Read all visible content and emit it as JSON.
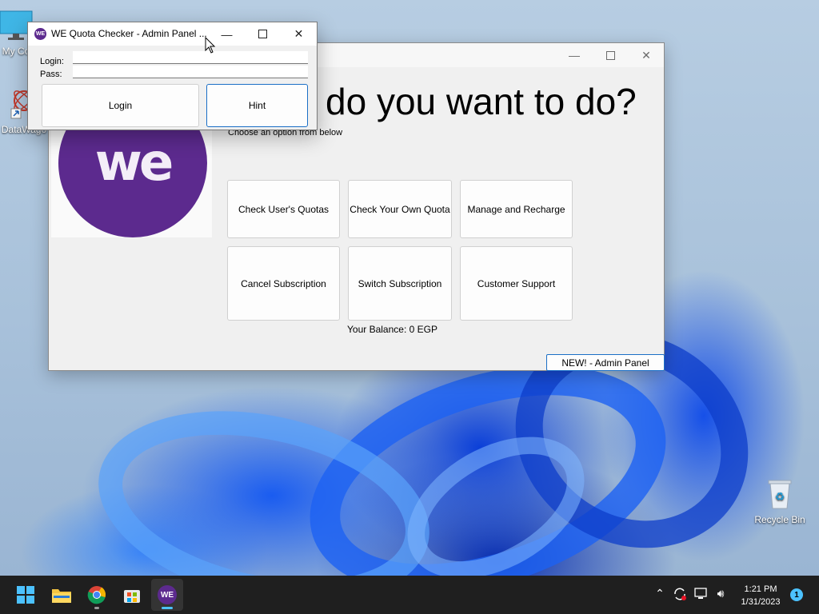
{
  "desktop": {
    "icons": [
      {
        "label": "My Co"
      },
      {
        "label": "DataWago"
      },
      {
        "label": "Recycle Bin"
      }
    ]
  },
  "main_window": {
    "heading": "do you want to do?",
    "subheading": "Choose an option from below",
    "logo_text": "we",
    "options": [
      {
        "label": "Check User's Quotas"
      },
      {
        "label": "Check Your Own Quota"
      },
      {
        "label": "Manage and Recharge"
      },
      {
        "label": "Cancel Subscription"
      },
      {
        "label": "Switch Subscription"
      },
      {
        "label": "Customer Support"
      }
    ],
    "balance": "Your Balance: 0 EGP",
    "admin_panel_label": "NEW! - Admin Panel"
  },
  "login_window": {
    "title": "WE Quota Checker - Admin Panel ...",
    "app_icon_text": "WE",
    "login_label": "Login:",
    "pass_label": "Pass:",
    "login_value": "",
    "pass_value": "",
    "login_button": "Login",
    "hint_button": "Hint"
  },
  "taskbar": {
    "apps": [
      {
        "icon": "windows-start-icon"
      },
      {
        "icon": "file-explorer-icon"
      },
      {
        "icon": "chrome-icon"
      },
      {
        "icon": "microsoft-store-icon"
      },
      {
        "icon": "we-app-icon",
        "text": "WE"
      }
    ],
    "clock_time": "1:21 PM",
    "clock_date": "1/31/2023",
    "notification_count": "1"
  },
  "colors": {
    "brand_purple": "#5c2a8e",
    "focus_blue": "#1b6fc6",
    "taskbar": "#1f1f1f"
  }
}
